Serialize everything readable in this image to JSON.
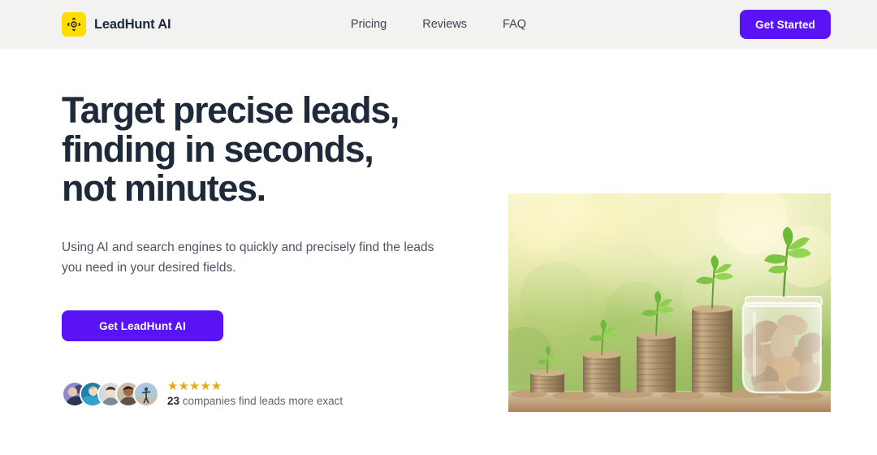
{
  "header": {
    "logo_icon": "focus-target-icon",
    "logo_bg": "#ffdd00",
    "brand": "LeadHunt AI",
    "nav": [
      {
        "label": "Pricing"
      },
      {
        "label": "Reviews"
      },
      {
        "label": "FAQ"
      }
    ],
    "cta_label": "Get Started",
    "cta_color": "#5a13f5",
    "background": "#f2f2f1"
  },
  "hero": {
    "headline": "Target precise leads,\nfinding in seconds,\nnot minutes.",
    "subhead": "Using AI and search engines to quickly and precisely find the leads you need in your desired fields.",
    "cta_label": "Get LeadHunt AI",
    "cta_color": "#5a13f5",
    "headline_color": "#1e2a3a",
    "social_proof": {
      "avatar_count": 5,
      "avatars": [
        {
          "name": "avatar-1",
          "bg": "#8f8ad0"
        },
        {
          "name": "avatar-2",
          "bg": "#1f7fa8"
        },
        {
          "name": "avatar-3",
          "bg": "#d6dadd"
        },
        {
          "name": "avatar-4",
          "bg": "#c9a88a"
        },
        {
          "name": "avatar-5",
          "bg": "#a9cbdd"
        }
      ],
      "stars": "★★★★★",
      "star_count": 5,
      "star_color": "#e5ad0c",
      "count": "23",
      "caption": " companies find leads more exact"
    },
    "image": {
      "alt": "coin stacks with plant sprouts and a glass jar full of coins",
      "name": "hero-photo-coins-growth"
    }
  }
}
